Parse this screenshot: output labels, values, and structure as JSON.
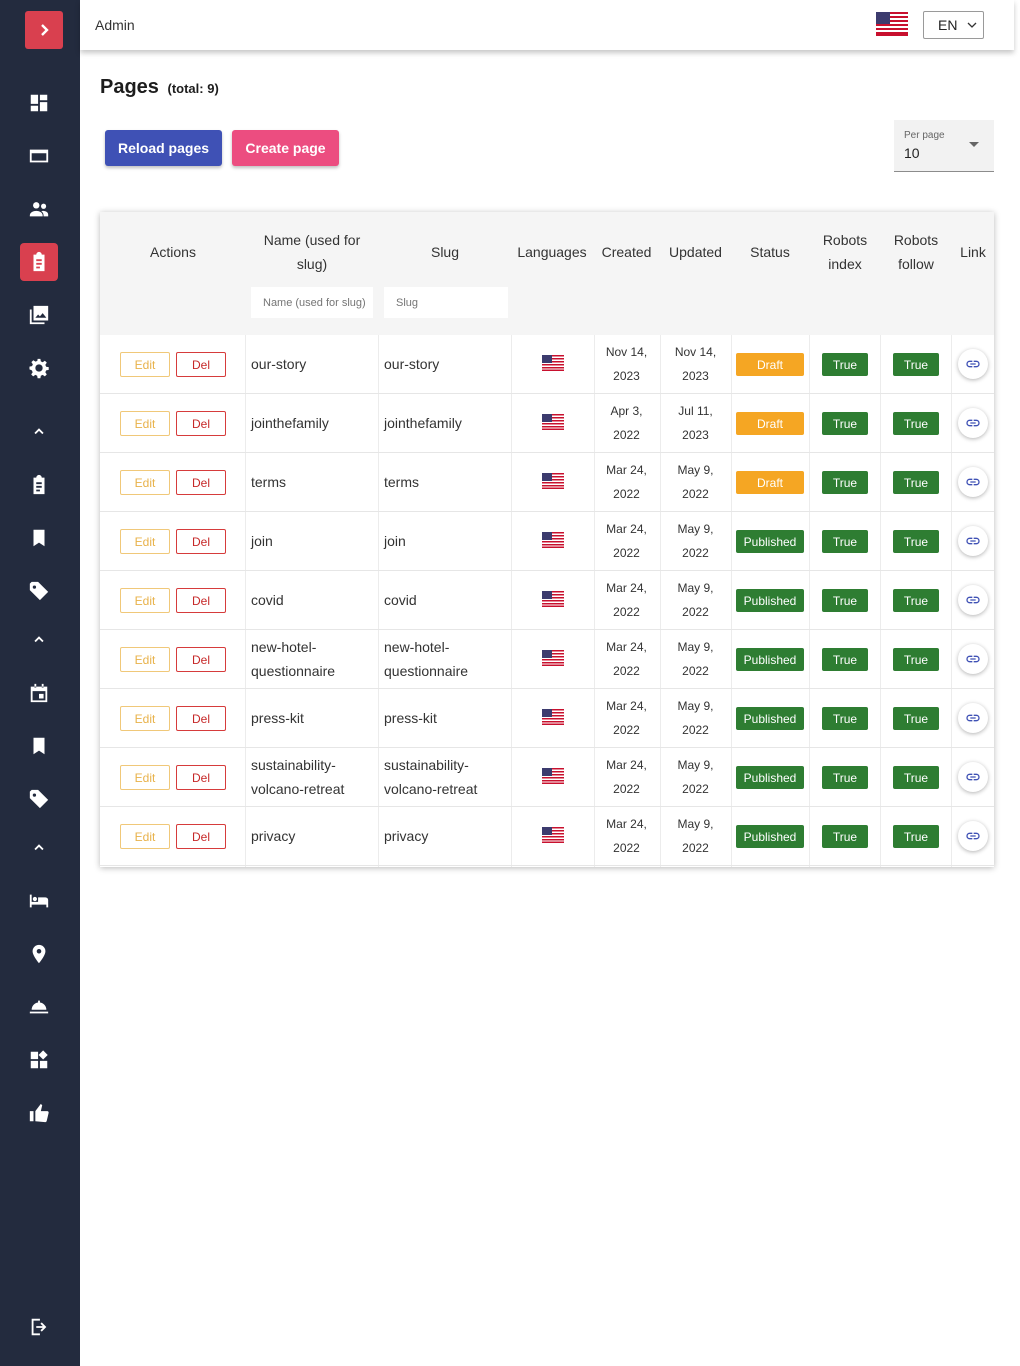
{
  "topbar": {
    "title": "Admin",
    "language": "EN"
  },
  "page": {
    "title": "Pages",
    "total": "(total: 9)"
  },
  "buttons": {
    "reload": "Reload pages",
    "create": "Create page"
  },
  "per_page": {
    "label": "Per page",
    "value": "10"
  },
  "table": {
    "headers": {
      "actions": "Actions",
      "name": "Name (used for slug)",
      "slug": "Slug",
      "languages": "Languages",
      "created": "Created",
      "updated": "Updated",
      "status": "Status",
      "robots_index": "Robots index",
      "robots_follow": "Robots follow",
      "link": "Link"
    },
    "filters": {
      "name_placeholder": "Name (used for slug)",
      "slug_placeholder": "Slug"
    },
    "edit_label": "Edit",
    "del_label": "Del",
    "rows": [
      {
        "name": "our-story",
        "slug": "our-story",
        "created": "Nov 14, 2023",
        "updated": "Nov 14, 2023",
        "status": "Draft",
        "robots_index": "True",
        "robots_follow": "True"
      },
      {
        "name": "jointhefamily",
        "slug": "jointhefamily",
        "created": "Apr 3, 2022",
        "updated": "Jul 11, 2023",
        "status": "Draft",
        "robots_index": "True",
        "robots_follow": "True"
      },
      {
        "name": "terms",
        "slug": "terms",
        "created": "Mar 24, 2022",
        "updated": "May 9, 2022",
        "status": "Draft",
        "robots_index": "True",
        "robots_follow": "True"
      },
      {
        "name": "join",
        "slug": "join",
        "created": "Mar 24, 2022",
        "updated": "May 9, 2022",
        "status": "Published",
        "robots_index": "True",
        "robots_follow": "True"
      },
      {
        "name": "covid",
        "slug": "covid",
        "created": "Mar 24, 2022",
        "updated": "May 9, 2022",
        "status": "Published",
        "robots_index": "True",
        "robots_follow": "True"
      },
      {
        "name": "new-hotel-questionnaire",
        "slug": "new-hotel-questionnaire",
        "created": "Mar 24, 2022",
        "updated": "May 9, 2022",
        "status": "Published",
        "robots_index": "True",
        "robots_follow": "True"
      },
      {
        "name": "press-kit",
        "slug": "press-kit",
        "created": "Mar 24, 2022",
        "updated": "May 9, 2022",
        "status": "Published",
        "robots_index": "True",
        "robots_follow": "True"
      },
      {
        "name": "sustainability-volcano-retreat",
        "slug": "sustainability-volcano-retreat",
        "created": "Mar 24, 2022",
        "updated": "May 9, 2022",
        "status": "Published",
        "robots_index": "True",
        "robots_follow": "True"
      },
      {
        "name": "privacy",
        "slug": "privacy",
        "created": "Mar 24, 2022",
        "updated": "May 9, 2022",
        "status": "Published",
        "robots_index": "True",
        "robots_follow": "True"
      }
    ]
  },
  "sidebar": {
    "items": [
      {
        "icon": "dashboard-icon",
        "active": false
      },
      {
        "icon": "credit-card-icon",
        "active": false
      },
      {
        "icon": "people-icon",
        "active": false
      },
      {
        "icon": "clipboard-icon",
        "active": true
      },
      {
        "icon": "photo-library-icon",
        "active": false
      },
      {
        "icon": "settings-icon",
        "active": false
      },
      {
        "icon": "chevron-up-icon",
        "active": false
      },
      {
        "icon": "clipboard-icon",
        "active": false
      },
      {
        "icon": "bookmark-icon",
        "active": false
      },
      {
        "icon": "tag-icon",
        "active": false
      },
      {
        "icon": "chevron-up-icon",
        "active": false
      },
      {
        "icon": "calendar-icon",
        "active": false
      },
      {
        "icon": "bookmark-icon",
        "active": false
      },
      {
        "icon": "tag-icon",
        "active": false
      },
      {
        "icon": "chevron-up-icon",
        "active": false
      },
      {
        "icon": "hotel-bed-icon",
        "active": false
      },
      {
        "icon": "location-pin-icon",
        "active": false
      },
      {
        "icon": "room-service-icon",
        "active": false
      },
      {
        "icon": "widgets-icon",
        "active": false
      },
      {
        "icon": "thumb-up-icon",
        "active": false
      },
      {
        "icon": "logout-icon",
        "active": false
      }
    ]
  },
  "colors": {
    "sidebar_bg": "#232b3e",
    "accent_red": "#d9404f",
    "reload_blue": "#3f51b5",
    "create_pink": "#ec4d80",
    "draft_orange": "#f5a623",
    "published_green": "#2e7d32"
  }
}
